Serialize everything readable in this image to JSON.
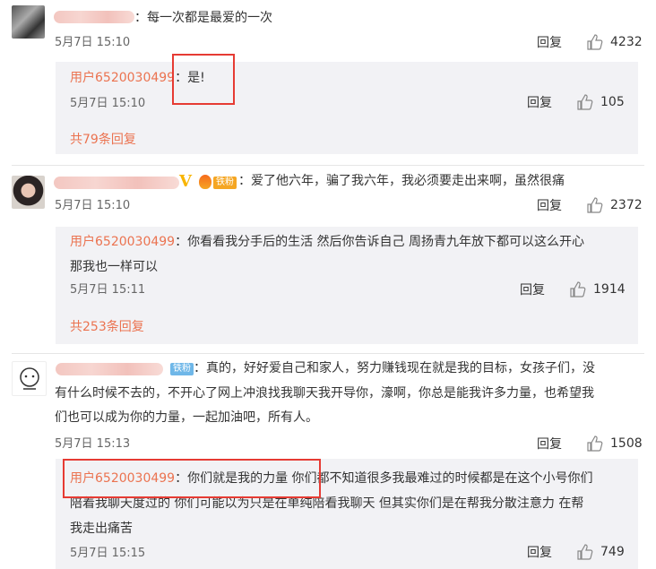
{
  "comments": [
    {
      "text": "：每一次都是最爱的一次",
      "time": "5月7日 15:10",
      "reply_label": "回复",
      "likes": "4232",
      "subreply": {
        "user": "用户6520030499",
        "text": "：是!",
        "time": "5月7日 15:10",
        "reply_label": "回复",
        "likes": "105"
      },
      "more": "共79条回复"
    },
    {
      "badge": "铁粉",
      "text": "：爱了他六年，骗了我六年，我必须要走出来啊，虽然很痛",
      "time": "5月7日 15:10",
      "reply_label": "回复",
      "likes": "2372",
      "subreply": {
        "user": "用户6520030499",
        "text_line1": "：你看看我分手后的生活 然后你告诉自己 周扬青九年放下都可以这么开心",
        "text_line2": "那我也一样可以",
        "time": "5月7日 15:11",
        "reply_label": "回复",
        "likes": "1914"
      },
      "more": "共253条回复"
    },
    {
      "badge": "铁粉",
      "text_line1": "：真的，好好爱自己和家人，努力赚钱现在就是我的目标，女孩子们，没",
      "text_line2": "有什么时候不去的，不开心了网上冲浪找我聊天我开导你，濠啊，你总是能我许多力量，也希望我",
      "text_line3": "们也可以成为你的力量，一起加油吧，所有人。",
      "time": "5月7日 15:13",
      "reply_label": "回复",
      "likes": "1508",
      "subreply": {
        "user": "用户6520030499",
        "text_line1": "：你们就是我的力量 你们都不知道很多我最难过的时候都是在这个小号你们",
        "text_line2": "陪着我聊天度过的 你们可能以为只是在单纯陪看我聊天 但其实你们是在帮我分散注意力 在帮",
        "text_line3": "我走出痛苦",
        "time": "5月7日 15:15",
        "reply_label": "回复",
        "likes": "749"
      }
    }
  ]
}
